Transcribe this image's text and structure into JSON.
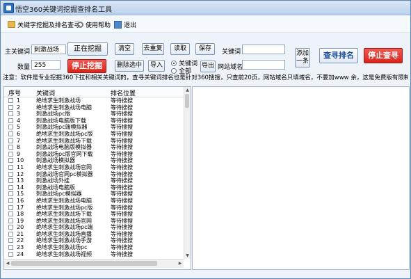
{
  "window": {
    "title": "悟空360关键词挖掘查排名工具"
  },
  "menu": [
    {
      "label": "关键字挖掘及排名查寻",
      "icon": "folder-icon"
    },
    {
      "label": "使用帮助",
      "icon": "gear-icon"
    },
    {
      "label": "退出",
      "icon": "exit-icon"
    }
  ],
  "panel": {
    "main_keyword_label": "主关键词",
    "main_keyword_value": "刺激战场",
    "quantity_label": "数量",
    "quantity_value": "255",
    "status_label": "正在挖掘",
    "stop_mining_label": "停止挖掘",
    "clear_label": "清空",
    "dedupe_label": "去重复",
    "delete_selected_label": "删除选中",
    "read_label": "读取",
    "import_label": "导入",
    "save_label": "保存",
    "export_label": "导出",
    "radio_keyword_label": "关键词",
    "radio_all_label": "全部",
    "keyword_field_label": "关键词",
    "keyword_field_value": "",
    "site_domain_label": "网站域名",
    "site_domain_value": "",
    "add_one_label": "添加一条",
    "query_rank_label": "查寻排名",
    "stop_query_label": "停止查寻",
    "notice": "注意：软件是专业挖掘360下拉和相关关键词的，查寻关键词排名也是针对360搜搜，只查前20页，网站域名只填域名，不要加www        余，这是免费版有限制哦"
  },
  "list": {
    "columns": [
      "序号",
      "关键词",
      "排名位置"
    ],
    "rows": [
      {
        "no": "1",
        "keyword": "绝地求生刺激战场",
        "status": "等待搜搜"
      },
      {
        "no": "2",
        "keyword": "绝地求生刺激战场电脑",
        "status": "等待搜搜"
      },
      {
        "no": "3",
        "keyword": "刺激战场pc版",
        "status": "等待搜搜"
      },
      {
        "no": "4",
        "keyword": "刺激战场电脑版下载",
        "status": "等待搜搜"
      },
      {
        "no": "5",
        "keyword": "刺激战场pc端模拟器",
        "status": "等待搜搜"
      },
      {
        "no": "6",
        "keyword": "绝地求生刺激战场pc版",
        "status": "等待搜搜"
      },
      {
        "no": "7",
        "keyword": "绝地求生刺激战场下载",
        "status": "等待搜搜"
      },
      {
        "no": "8",
        "keyword": "刺激战场电脑版模拟器",
        "status": "等待搜搜"
      },
      {
        "no": "9",
        "keyword": "刺激战场pc版官网下载",
        "status": "等待搜搜"
      },
      {
        "no": "10",
        "keyword": "刺激战场模拟器",
        "status": "等待搜搜"
      },
      {
        "no": "11",
        "keyword": "绝地求生刺激战场官网",
        "status": "等待搜搜"
      },
      {
        "no": "12",
        "keyword": "刺激战场官网pc模拟器",
        "status": "等待搜搜"
      },
      {
        "no": "13",
        "keyword": "刺激战场外挂",
        "status": "等待搜搜"
      },
      {
        "no": "14",
        "keyword": "刺激战场电脑版",
        "status": "等待搜搜"
      },
      {
        "no": "15",
        "keyword": "刺激战场pc模拟器",
        "status": "等待搜搜"
      },
      {
        "no": "16",
        "keyword": "绝地求生刺激战场电脑",
        "status": "等待搜搜"
      },
      {
        "no": "17",
        "keyword": "绝地求生刺激战场pc版",
        "status": "等待搜搜"
      },
      {
        "no": "18",
        "keyword": "绝地求生刺激战场下载",
        "status": "等待搜搜"
      },
      {
        "no": "19",
        "keyword": "绝地求生刺激战场官网",
        "status": "等待搜搜"
      },
      {
        "no": "20",
        "keyword": "绝地求生刺激战场pc端",
        "status": "等待搜搜"
      },
      {
        "no": "21",
        "keyword": "绝地求生刺激战场直播",
        "status": "等待搜搜"
      },
      {
        "no": "22",
        "keyword": "绝地求生刺激战场手游",
        "status": "等待搜搜"
      },
      {
        "no": "23",
        "keyword": "绝地求生刺激战场pc",
        "status": "等待搜搜"
      },
      {
        "no": "24",
        "keyword": "绝地求生刺激战场视频",
        "status": "等待搜搜"
      }
    ]
  }
}
